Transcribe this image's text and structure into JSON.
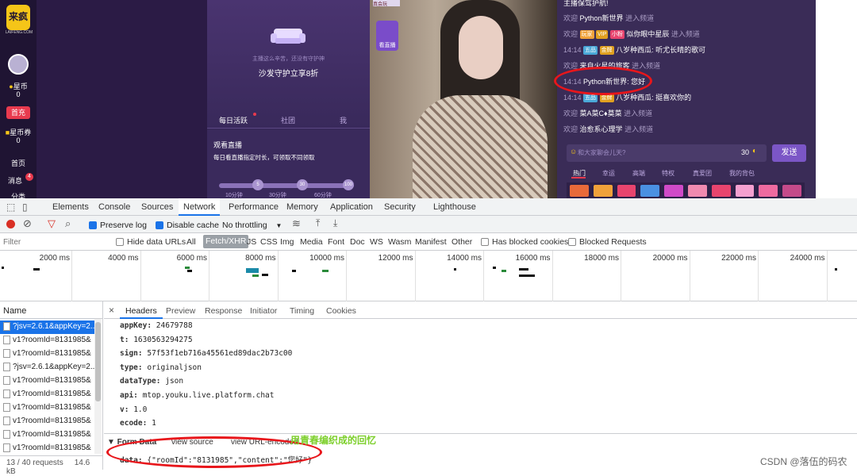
{
  "webpage": {
    "logo": "来疯",
    "logo_sub": "LAIFENG.COM",
    "sidebar": [
      {
        "label": "星币",
        "value": "0"
      },
      {
        "label": "首充"
      },
      {
        "label": "星币券",
        "value": "0"
      },
      {
        "label": "首页"
      },
      {
        "label": "消息",
        "badge": "4"
      },
      {
        "label": "分类"
      }
    ],
    "guard_panel": {
      "hint": "主播这么辛苦，还没有守护神",
      "offer": "沙发守护立享8折",
      "tabs": [
        "每日活跃",
        "社团",
        "我"
      ],
      "task_title": "观看直播",
      "task_desc": "每日看直播指定时长，可领取不同领取",
      "progress_marks": [
        "5",
        "30",
        "100"
      ],
      "progress_labels": [
        "10分钟",
        "30分钟",
        "60分钟"
      ]
    },
    "video": {
      "live_label": "看直播",
      "top_tag": "真会玩"
    },
    "chat": {
      "lines": [
        {
          "prefix": "",
          "name": "主播保驾护航!",
          "msg": ""
        },
        {
          "prefix": "欢迎",
          "name": "Python新世界",
          "msg": "进入频道"
        },
        {
          "prefix": "欢迎",
          "badges": [
            "玩家",
            "VIP",
            "小粉"
          ],
          "name": "似你眼中星辰",
          "msg": "进入频道"
        },
        {
          "prefix": "14:14",
          "badges": [
            "五品",
            "金牌"
          ],
          "name": "八岁种西瓜:",
          "msg": "听尤长晴的歌可"
        },
        {
          "prefix": "欢迎",
          "name": "来自火星的旅客",
          "msg": "进入频道"
        },
        {
          "prefix": "14:14",
          "name": "Python新世界:",
          "msg": "您好"
        },
        {
          "prefix": "14:14",
          "badges": [
            "五品",
            "金牌"
          ],
          "name": "八岁种西瓜:",
          "msg": "挺喜欢你的"
        },
        {
          "prefix": "欢迎",
          "name": "菜A菜C♦莫菜",
          "msg": "进入频道"
        },
        {
          "prefix": "欢迎",
          "name": "治愈系心理学",
          "msg": "进入频道"
        }
      ],
      "input_placeholder": "和大家聊会儿天?",
      "char_count": "30",
      "send_label": "发送",
      "tabs": [
        "热门",
        "幸运",
        "高端",
        "特权",
        "真爱团",
        "我的背包"
      ]
    }
  },
  "devtools": {
    "tabs": [
      "Elements",
      "Console",
      "Sources",
      "Network",
      "Performance",
      "Memory",
      "Application",
      "Security",
      "Lighthouse"
    ],
    "toolbar": {
      "preserve_log": "Preserve log",
      "disable_cache": "Disable cache",
      "throttling": "No throttling"
    },
    "filter_bar": {
      "placeholder": "Filter",
      "hide_data_urls": "Hide data URLs",
      "types": [
        "All",
        "Fetch/XHR",
        "JS",
        "CSS",
        "Img",
        "Media",
        "Font",
        "Doc",
        "WS",
        "Wasm",
        "Manifest",
        "Other"
      ],
      "blocked_cookies": "Has blocked cookies",
      "blocked_requests": "Blocked Requests"
    },
    "timeline_labels": [
      "2000 ms",
      "4000 ms",
      "6000 ms",
      "8000 ms",
      "10000 ms",
      "12000 ms",
      "14000 ms",
      "16000 ms",
      "18000 ms",
      "20000 ms",
      "22000 ms",
      "24000 ms"
    ],
    "request_list": {
      "header": "Name",
      "rows": [
        "?jsv=2.6.1&appKey=2...",
        "v1?roomId=8131985&",
        "v1?roomId=8131985&",
        "?jsv=2.6.1&appKey=2...",
        "v1?roomId=8131985&",
        "v1?roomId=8131985&",
        "v1?roomId=8131985&",
        "v1?roomId=8131985&",
        "v1?roomId=8131985&",
        "v1?roomId=8131985&"
      ],
      "status": "13 / 40 requests",
      "size": "14.6 kB"
    },
    "detail": {
      "tabs": [
        "Headers",
        "Preview",
        "Response",
        "Initiator",
        "Timing",
        "Cookies"
      ],
      "params": [
        {
          "key": "appKey:",
          "value": "24679788"
        },
        {
          "key": "t:",
          "value": "1630563294275"
        },
        {
          "key": "sign:",
          "value": "57f53f1eb716a45561ed89dac2b73c00"
        },
        {
          "key": "type:",
          "value": "originaljson"
        },
        {
          "key": "dataType:",
          "value": "json"
        },
        {
          "key": "api:",
          "value": "mtop.youku.live.platform.chat"
        },
        {
          "key": "v:",
          "value": "1.0"
        },
        {
          "key": "ecode:",
          "value": "1"
        }
      ],
      "form_data_title": "▼ Form Data",
      "view_source": "view source",
      "view_url_encoded": "view URL-encoded",
      "data_key": "data:",
      "data_value": "{\"roomId\":\"8131985\",\"content\":\"您好\"}"
    }
  },
  "annotation_note": "用青春编织成的回忆",
  "watermark": "CSDN @落伍的码农"
}
